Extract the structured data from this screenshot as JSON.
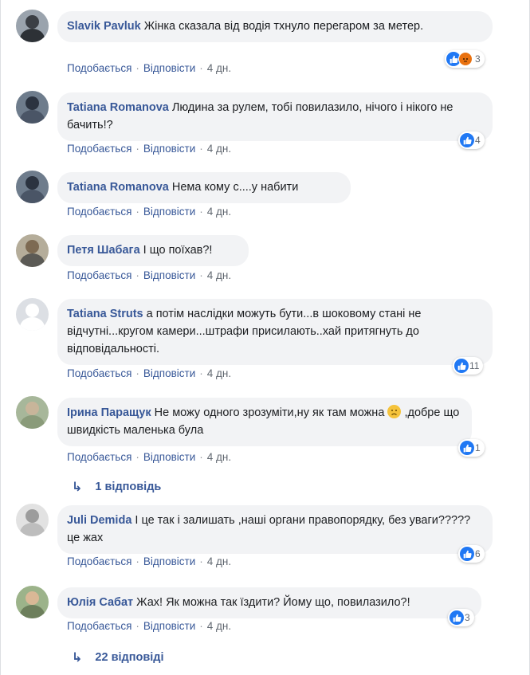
{
  "comments": [
    {
      "author": "Slavik Pavluk",
      "text": "Жінка сказала від водія тхнуло перегаром за метер.",
      "reactions": "3",
      "reaction_types": [
        "like-icon",
        "angry-icon"
      ]
    },
    {
      "author": "Tatiana Romanova",
      "text": "Людина за рулем, тобі повилазило, нічого і нікого не бачить!?",
      "reactions": "4",
      "reaction_types": [
        "like-icon"
      ]
    },
    {
      "author": "Tatiana Romanova",
      "text": "Нема кому с....у набити",
      "reactions": "",
      "reaction_types": []
    },
    {
      "author": "Петя Шабага",
      "text": "І що поїхав?!",
      "reactions": "",
      "reaction_types": []
    },
    {
      "author": "Tatiana Struts",
      "text": "а потім наслідки можуть бути...в шоковому стані не відчутні...кругом камери...штрафи присилають..хай притягнуть до відповідальності.",
      "reactions": "11",
      "reaction_types": [
        "like-icon"
      ]
    },
    {
      "author": "Ірина Паращук",
      "text": "Не можу одного зрозуміти,ну як там можна",
      "text2": ",добре що швидкість маленька була",
      "reactions": "1",
      "reaction_types": [
        "like-icon"
      ]
    },
    {
      "author": "Juli Demida",
      "text": "І це так і залишать ,наші органи правопорядку, без уваги?????це жах",
      "reactions": "6",
      "reaction_types": [
        "like-icon"
      ]
    },
    {
      "author": "Юлія Сабат",
      "text": "Жах! Як можна так їздити? Йому що, повилазило?!",
      "reactions": "3",
      "reaction_types": [
        "like-icon"
      ]
    }
  ],
  "actions": {
    "like": "Подобається",
    "reply": "Відповісти",
    "time": "4 дн.",
    "separator": "·"
  },
  "replies": {
    "one": "1 відповідь",
    "many": "22 відповіді"
  },
  "colors": {
    "link": "#385898",
    "bubble": "#f2f3f5",
    "like": "#2078f4",
    "angry": "#e9710f"
  }
}
